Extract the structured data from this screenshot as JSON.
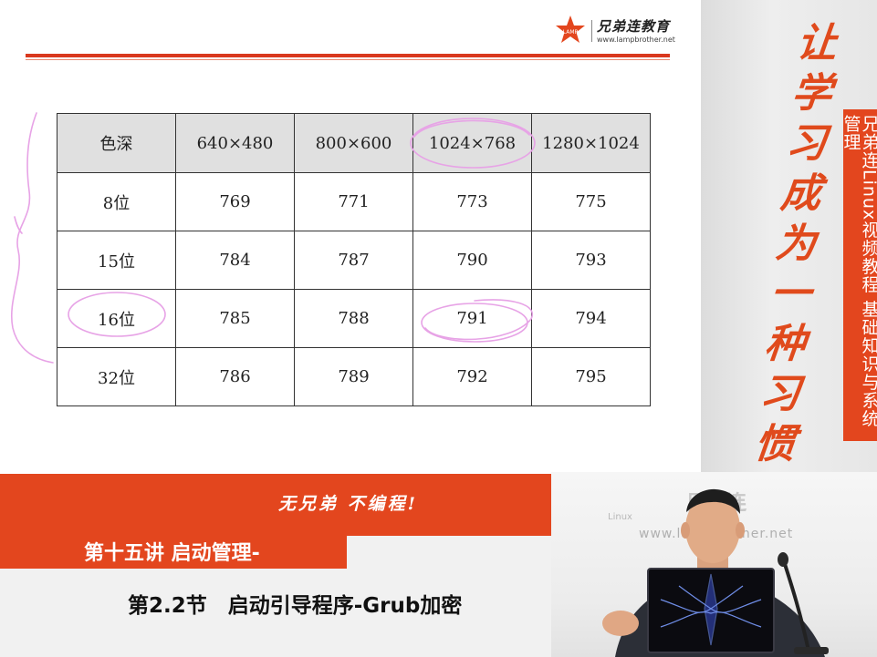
{
  "logo": {
    "brand": "兄弟连教育",
    "url": "www.lampbrother.net",
    "mark_text": "LAMP"
  },
  "table": {
    "header": [
      "色深",
      "640×480",
      "800×600",
      "1024×768",
      "1280×1024"
    ],
    "rows": [
      [
        "8位",
        "769",
        "771",
        "773",
        "775"
      ],
      [
        "15位",
        "784",
        "787",
        "790",
        "793"
      ],
      [
        "16位",
        "785",
        "788",
        "791",
        "794"
      ],
      [
        "32位",
        "786",
        "789",
        "792",
        "795"
      ]
    ]
  },
  "sidebar": {
    "slogan": "让学习成为一种习惯",
    "course": "兄弟连Linux视频教程 基础知识与系统管理"
  },
  "banner": {
    "tagline": "无兄弟 不编程!",
    "lecture": "第十五讲 启动管理-",
    "section": "第2.2节　启动引导程序-Grub加密"
  },
  "video": {
    "watermark_brand": "兄弟连",
    "watermark_url": "www.lampbrother.net",
    "watermark_linux": "Linux"
  },
  "colors": {
    "accent": "#e3461e",
    "annotation": "#e7a3e6"
  }
}
